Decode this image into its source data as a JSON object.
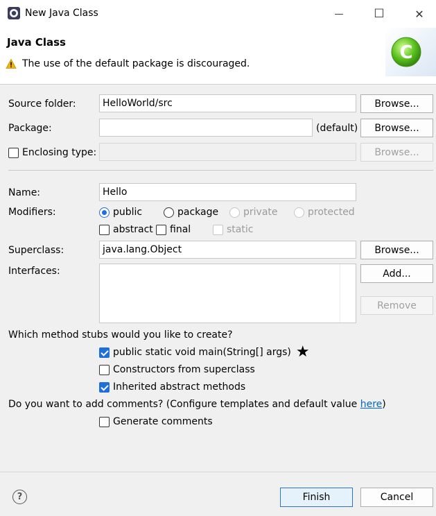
{
  "window": {
    "title": "New Java Class",
    "minimize_glyph": "—",
    "maximize_glyph": "☐",
    "close_glyph": "✕"
  },
  "header": {
    "title": "Java Class",
    "message": "The use of the default package is discouraged.",
    "warning_icon": "warning-icon",
    "art_icon": "java-class-wizard-icon"
  },
  "form": {
    "source_folder": {
      "label": "Source folder:",
      "value": "HelloWorld/src",
      "browse": "Browse..."
    },
    "package": {
      "label": "Package:",
      "value": "",
      "hint": "(default)",
      "browse": "Browse..."
    },
    "enclosing": {
      "label": "Enclosing type:",
      "value": "",
      "browse": "Browse...",
      "checked": false
    },
    "name": {
      "label": "Name:",
      "value": "Hello"
    },
    "modifiers": {
      "label": "Modifiers:",
      "public": "public",
      "package": "package",
      "private": "private",
      "protected": "protected",
      "abstract": "abstract",
      "final": "final",
      "static": "static",
      "selected": "public"
    },
    "superclass": {
      "label": "Superclass:",
      "value": "java.lang.Object",
      "browse": "Browse..."
    },
    "interfaces": {
      "label": "Interfaces:",
      "add": "Add...",
      "remove": "Remove",
      "items": []
    },
    "stubs": {
      "question": "Which method stubs would you like to create?",
      "main": "public static void main(String[] args)",
      "main_checked": true,
      "star": "★",
      "constructors": "Constructors from superclass",
      "constructors_checked": false,
      "inherited": "Inherited abstract methods",
      "inherited_checked": true
    },
    "comments": {
      "question_prefix": "Do you want to add comments? (Configure templates and default value ",
      "link": "here",
      "question_suffix": ")",
      "generate": "Generate comments",
      "generate_checked": false
    }
  },
  "footer": {
    "help_glyph": "?",
    "finish": "Finish",
    "cancel": "Cancel"
  },
  "colors": {
    "accent": "#1e6fd9",
    "link": "#0066cc",
    "warning": "#f2b600",
    "brand_green": "#5cc31f"
  }
}
